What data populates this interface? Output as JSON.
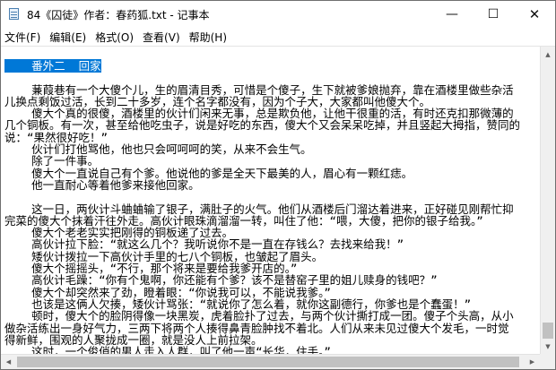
{
  "window": {
    "title": "84《囚徒》作者：春药狐.txt - 记事本",
    "minimize": "—",
    "maximize": "☐",
    "close": "✕"
  },
  "menu": [
    "文件(F)",
    "编辑(E)",
    "格式(O)",
    "查看(V)",
    "帮助(H)"
  ],
  "content": {
    "selected": "    番外二  回家",
    "lines": [
      "",
      "    蒹葭巷有一个大傻个儿，生的眉清目秀，可惜是个傻子，生下就被爹娘抛弃，靠在酒楼里做些杂活",
      "儿换点剩饭过活，长到二十多岁，连个名字都没有，因为个子大，大家都叫他傻大个。",
      "    傻大个真的很傻，酒楼里的伙计们闲来无事，总是欺负他，让他干很重的活，有时还克扣那微薄的",
      "几个铜板。有一次，甚至给他吃虫子，说是好吃的东西，傻大个又会呆呆吃掉，并且竖起大拇指，赞同的",
      "说：“果然很好吃！”",
      "    伙计们打他骂他，他也只会呵呵呵的笑，从来不会生气。",
      "    除了一件事。",
      "    傻大个一直说自己有个爹。他说他的爹是全天下最美的人，眉心有一颗红痣。",
      "    他一直耐心等着他爹来接他回家。",
      "",
      "    这一日，两伙计斗蛐蛐输了银子，满肚子的火气。他们从酒楼后门溜达着进来，正好碰见刚帮忙抑",
      "完菜的傻大个抹着汗往外走。高伙计眼珠滴溜溜一转，叫住了他：“喂，大傻，把你的银子给我。”",
      "    傻大个老老实实把刚得的铜板递了过去。",
      "    高伙计拉下脸：“就这么几个？我听说你不是一直在存钱么？去找来给我！”",
      "    矮伙计拨拉一下高伙计手里的七八个铜板，也皱起了眉头。",
      "    傻大个摇摇头，“不行，那个将来是要给我爹开店的。”",
      "    高伙计毛躁：“你有个鬼啊，你还能有个爹？该不是替窑子里的姐儿赎身的钱吧？”",
      "    傻大个却突然来了劲，瞪着眼：“你说我可以，不能说我爹。”",
      "    也该是这俩人欠揍，矮伙计骂张：“就说你了怎么着，就你这副德行，你爹也是个蠢蛋！”",
      "    顿时，傻大个的脸阴得像一块黑炭，虎着脸扑了过去，与两个伙计撕打成一团。傻子个头高，从小",
      "做杂活练出一身好气力，三两下将两个人揍得鼻青脸肿找不着北。人们从来未见过傻大个发毛，一时觉",
      "得新鲜，围观的人聚拢成一圈，就是没人上前拉架。",
      "    这时，一个俊俏的男人走入人群，叫了他一声“长华，住手。”"
    ]
  }
}
